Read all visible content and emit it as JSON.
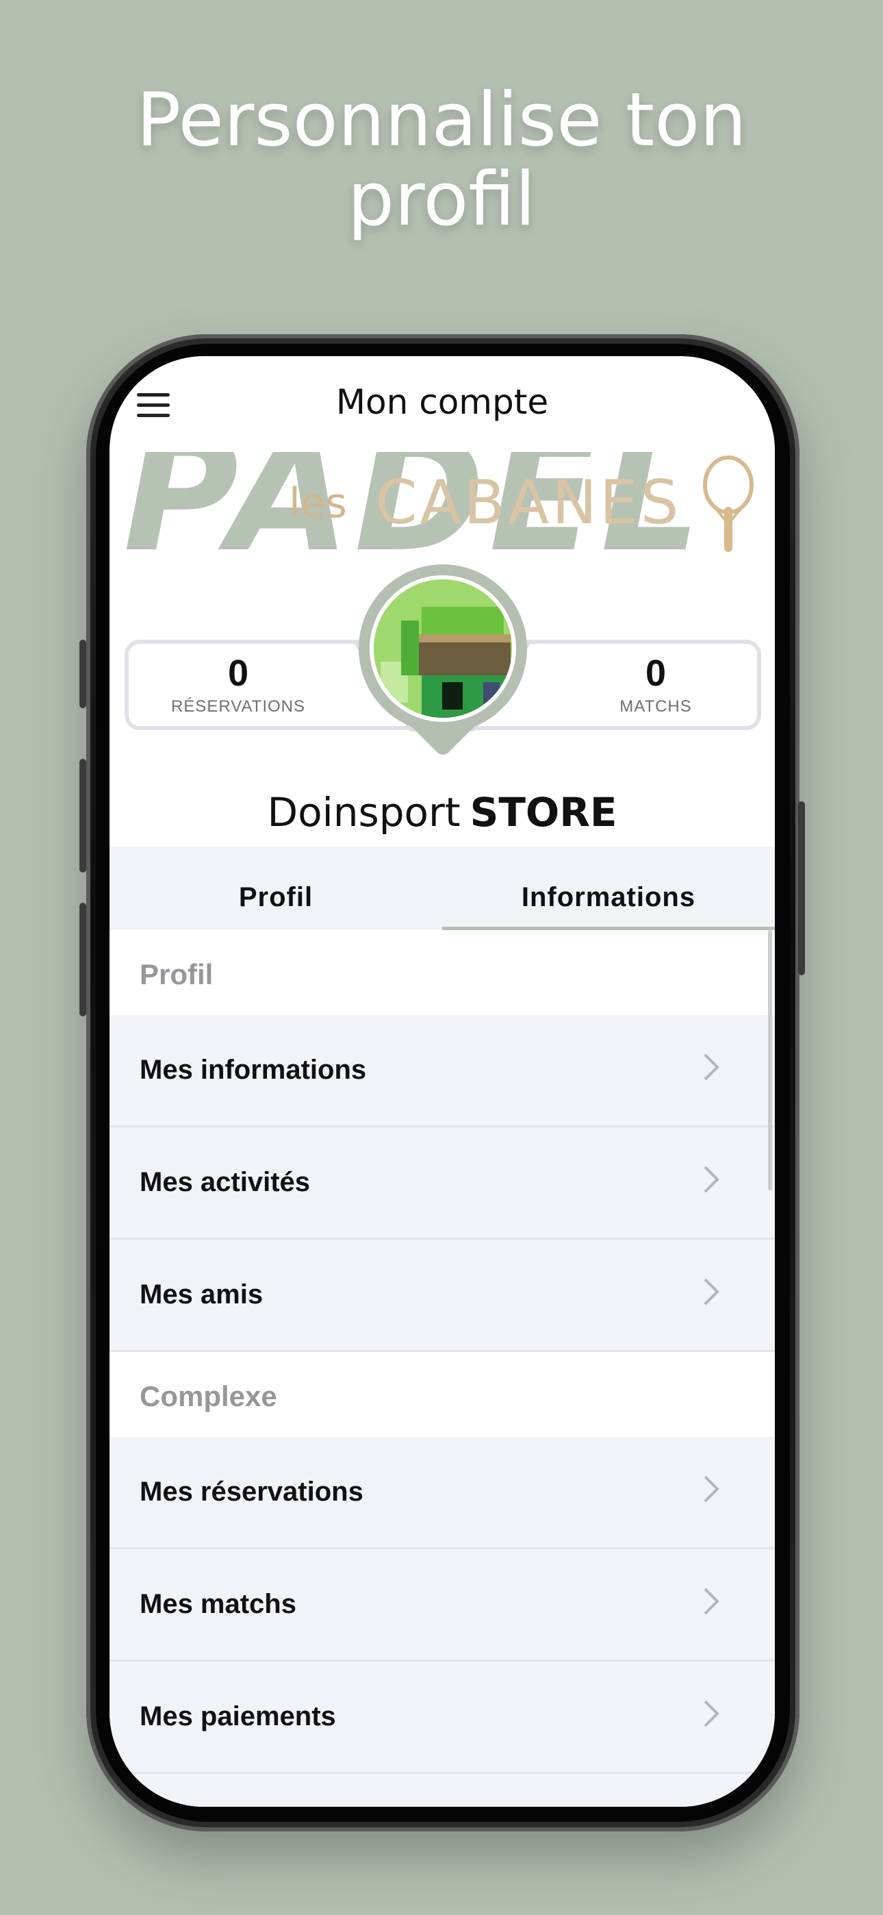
{
  "headline": {
    "line1": "Personnalise ton",
    "line2": "profil"
  },
  "screen": {
    "title": "Mon compte",
    "banner": {
      "big": "PADEL",
      "small": "les",
      "name": "CABANES"
    },
    "stats": [
      {
        "value": "0",
        "label": "RÉSERVATIONS"
      },
      {
        "value": "0",
        "label": "MATCHS"
      }
    ],
    "user": {
      "first": "Doinsport",
      "last": "STORE"
    },
    "tabs": [
      {
        "label": "Profil"
      },
      {
        "label": "Informations"
      }
    ],
    "sections": [
      {
        "title": "Profil",
        "items": [
          "Mes informations",
          "Mes activités",
          "Mes amis"
        ]
      },
      {
        "title": "Complexe",
        "items": [
          "Mes réservations",
          "Mes matchs",
          "Mes paiements"
        ]
      }
    ]
  },
  "colors": {
    "background": "#b4bfb2",
    "accent": "#b4bfb2",
    "banner_gold": "#d8c4a4",
    "list_bg": "#f2f3f7"
  },
  "icons": [
    "menu-icon",
    "chevron-right-icon",
    "racket-icon"
  ]
}
